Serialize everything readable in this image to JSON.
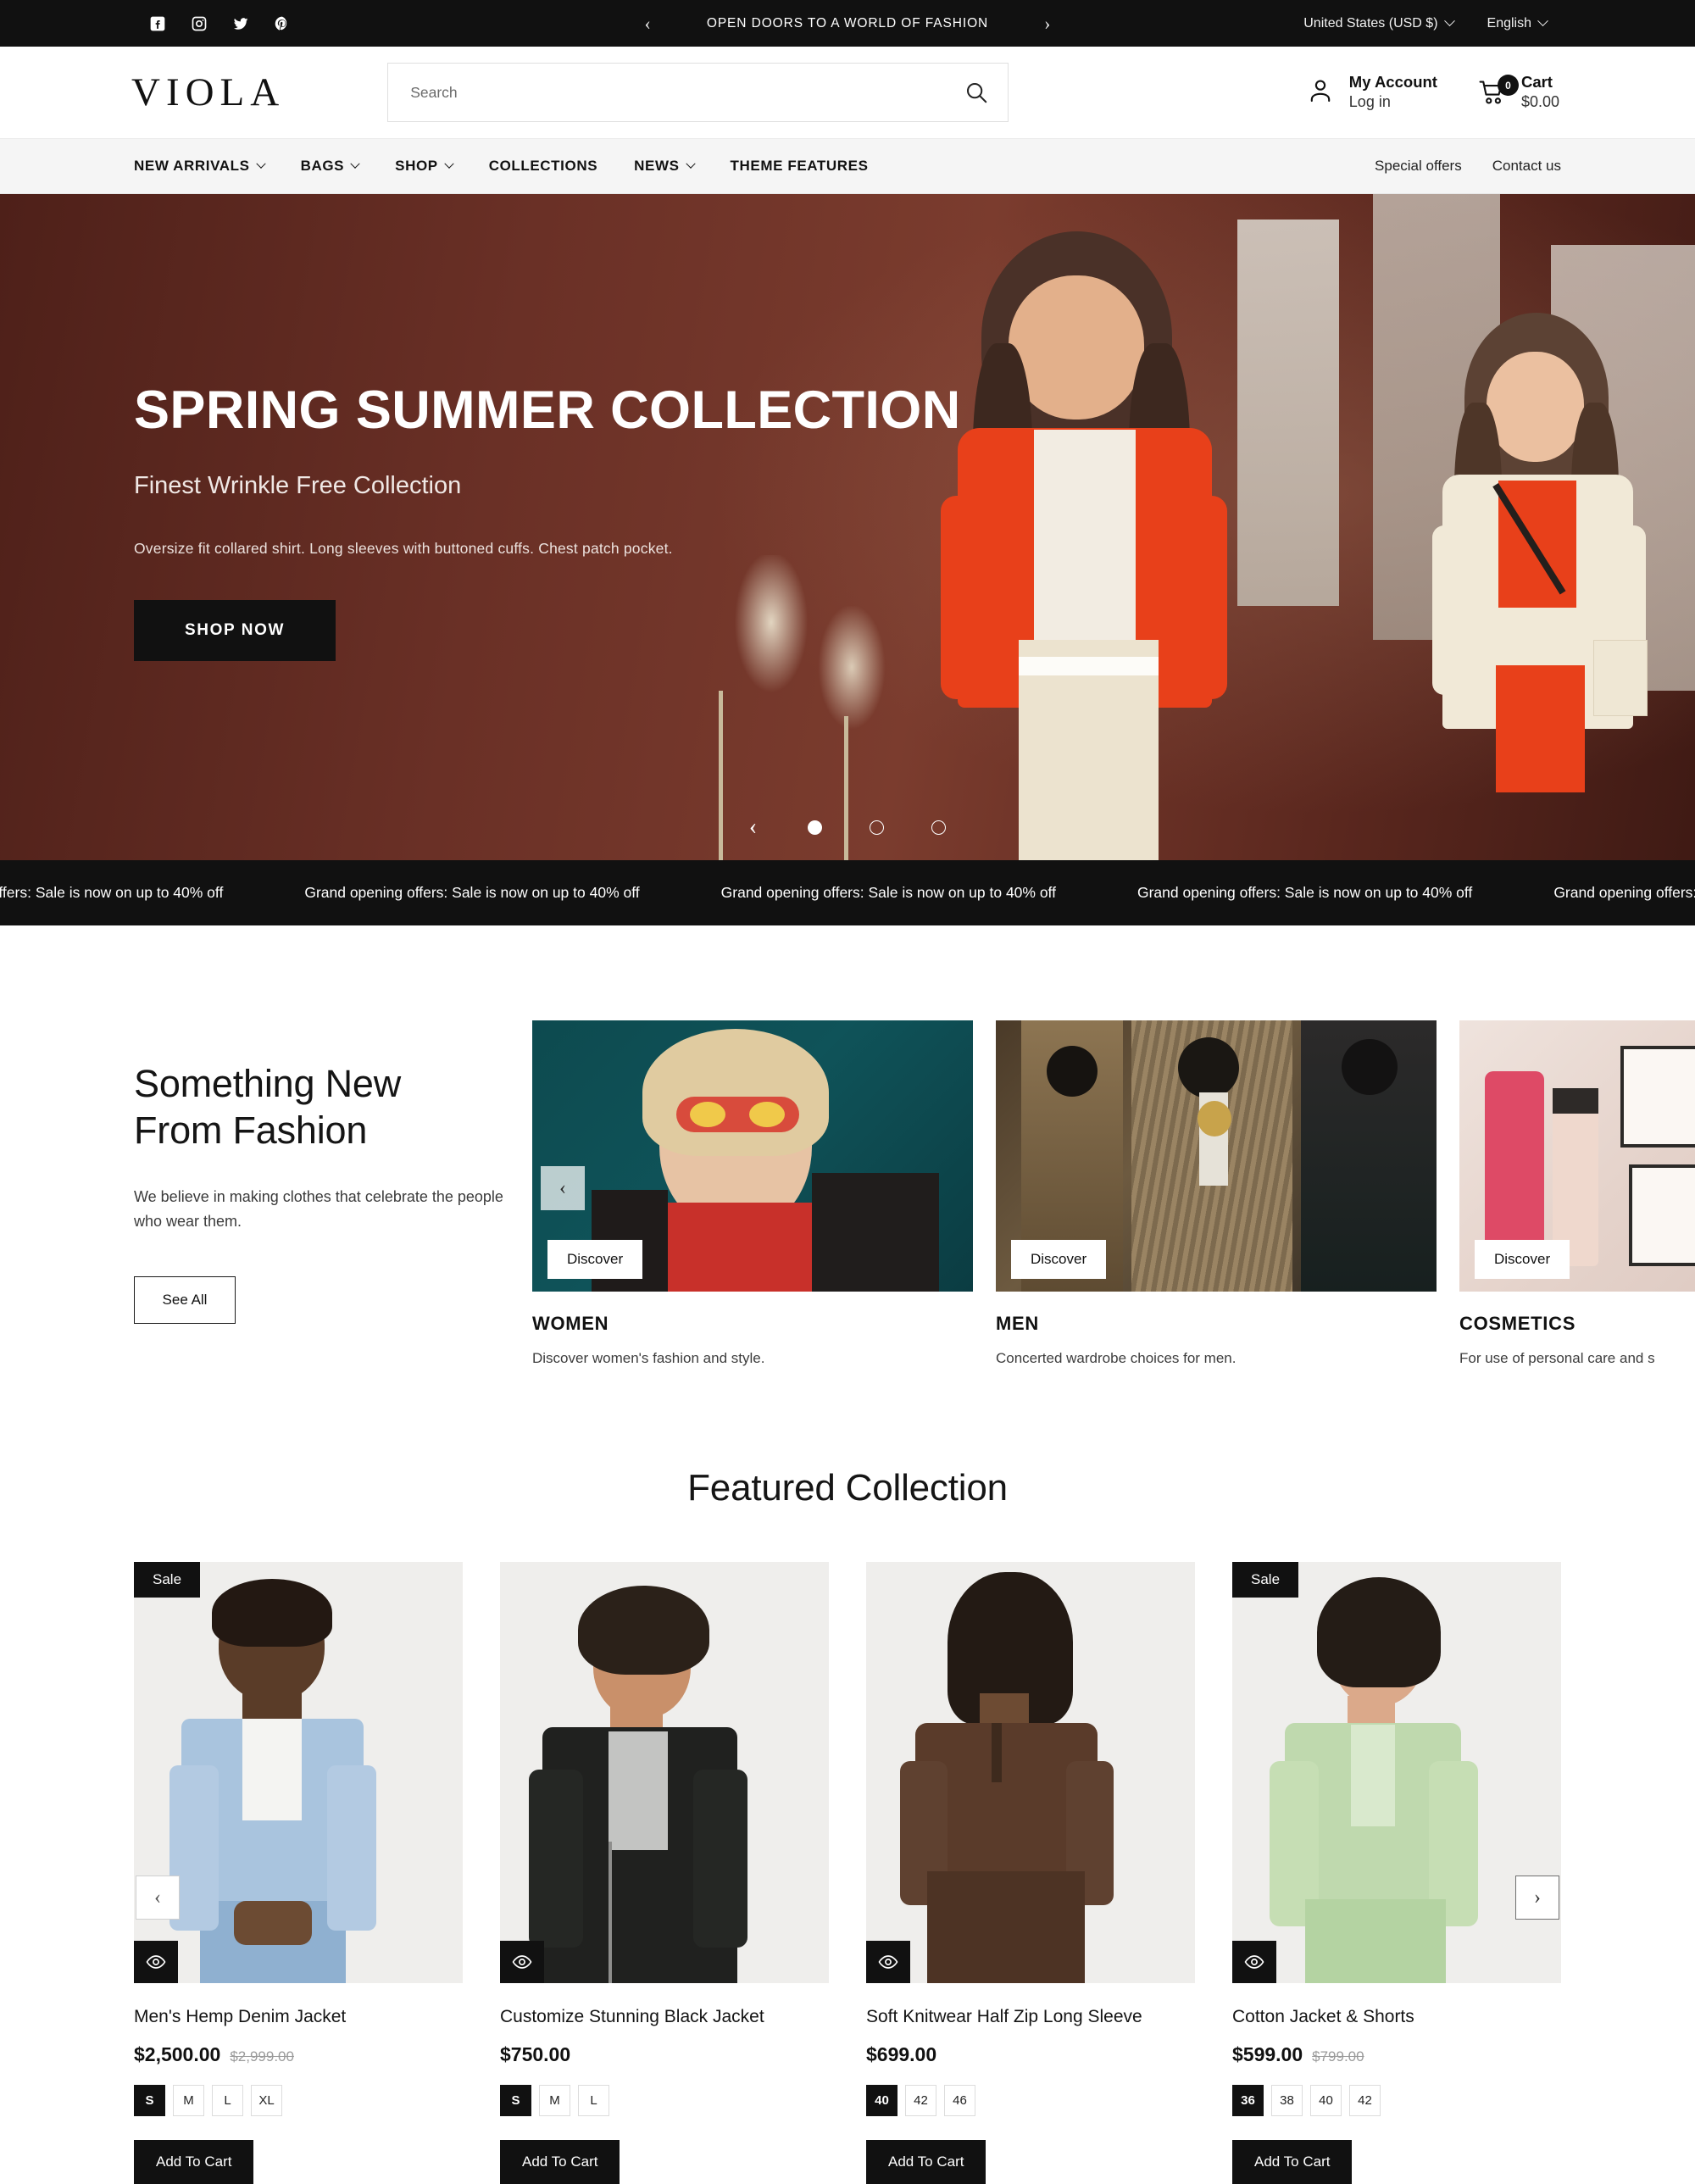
{
  "topbar": {
    "social": [
      {
        "name": "facebook-icon",
        "label": "Facebook"
      },
      {
        "name": "instagram-icon",
        "label": "Instagram"
      },
      {
        "name": "twitter-icon",
        "label": "Twitter"
      },
      {
        "name": "pinterest-icon",
        "label": "Pinterest"
      }
    ],
    "announcement": "OPEN DOORS TO A WORLD OF FASHION",
    "prev_label": "‹",
    "next_label": "›",
    "country": "United States (USD $)",
    "language": "English"
  },
  "header": {
    "logo": "VIOLA",
    "search": {
      "placeholder": "Search",
      "value": "",
      "icon": "search-icon"
    },
    "account": {
      "icon": "user-icon",
      "title": "My Account",
      "subtitle": "Log in"
    },
    "cart": {
      "icon": "cart-icon",
      "count": "0",
      "title": "Cart",
      "total": "$0.00"
    }
  },
  "nav": {
    "items": [
      {
        "label": "NEW ARRIVALS",
        "has_dropdown": true
      },
      {
        "label": "BAGS",
        "has_dropdown": true
      },
      {
        "label": "SHOP",
        "has_dropdown": true
      },
      {
        "label": "COLLECTIONS",
        "has_dropdown": false
      },
      {
        "label": "NEWS",
        "has_dropdown": true
      },
      {
        "label": "THEME FEATURES",
        "has_dropdown": false
      }
    ],
    "right": [
      {
        "label": "Special offers"
      },
      {
        "label": "Contact us"
      }
    ]
  },
  "hero": {
    "title": "SPRING SUMMER COLLECTION",
    "subtitle": "Finest Wrinkle Free Collection",
    "description": "Oversize fit collared shirt. Long sleeves with buttoned cuffs. Chest patch pocket.",
    "button": "SHOP NOW",
    "prev_label": "‹",
    "slides": 3,
    "active_slide": 1
  },
  "marquee": {
    "text": "Grand opening offers: Sale is now on up to 40% off",
    "repeat": 7
  },
  "new_section": {
    "title_line1": "Something New",
    "title_line2": "From Fashion",
    "description": "We believe in making clothes that celebrate the people who wear them.",
    "button": "See All",
    "prev_label": "‹",
    "next_label": "›",
    "categories": [
      {
        "name": "WOMEN",
        "description": "Discover women's fashion and style.",
        "cta": "Discover"
      },
      {
        "name": "MEN",
        "description": "Concerted wardrobe choices for men.",
        "cta": "Discover"
      },
      {
        "name": "COSMETICS",
        "description": "For use of personal care and s",
        "cta": "Discover"
      }
    ]
  },
  "featured": {
    "title": "Featured Collection",
    "prev_label": "‹",
    "next_label": "›",
    "add_to_cart": "Add To Cart",
    "sale_label": "Sale",
    "quickview_icon": "eye-icon",
    "products": [
      {
        "name": "Men's Hemp Denim Jacket",
        "price": "$2,500.00",
        "compare_at": "$2,999.00",
        "on_sale": true,
        "sizes": [
          "S",
          "M",
          "L",
          "XL"
        ],
        "selected_size": "S"
      },
      {
        "name": "Customize Stunning Black Jacket",
        "price": "$750.00",
        "compare_at": "",
        "on_sale": false,
        "sizes": [
          "S",
          "M",
          "L"
        ],
        "selected_size": "S"
      },
      {
        "name": "Soft Knitwear Half Zip Long Sleeve",
        "price": "$699.00",
        "compare_at": "",
        "on_sale": false,
        "sizes": [
          "40",
          "42",
          "46"
        ],
        "selected_size": "40"
      },
      {
        "name": "Cotton Jacket & Shorts",
        "price": "$599.00",
        "compare_at": "$799.00",
        "on_sale": true,
        "sizes": [
          "36",
          "38",
          "40",
          "42"
        ],
        "selected_size": "36"
      }
    ]
  },
  "colors": {
    "dark": "#111111",
    "nav_bg": "#f5f5f5",
    "hero_bg": "#5d2a22",
    "accent_orange": "#e8401a"
  }
}
